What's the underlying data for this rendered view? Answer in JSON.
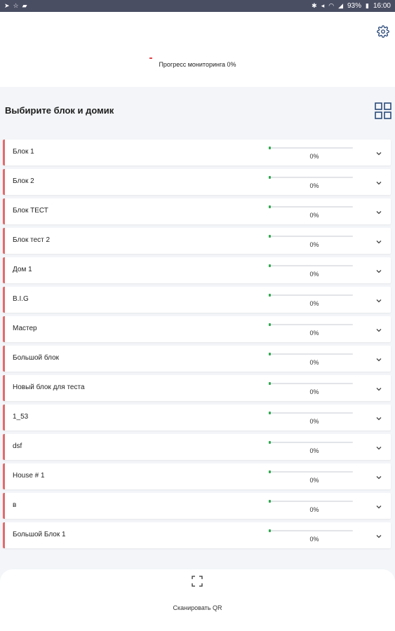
{
  "status_bar": {
    "battery": "93%",
    "time": "16:00"
  },
  "header": {
    "progress_label": "Прогресс мониторинга 0%"
  },
  "section": {
    "title": "Выбирите блок и домик"
  },
  "blocks": [
    {
      "name": "Блок 1",
      "percent": "0%",
      "progress": 0
    },
    {
      "name": "Блок 2",
      "percent": "0%",
      "progress": 0
    },
    {
      "name": "Блок ТЕСТ",
      "percent": "0%",
      "progress": 0
    },
    {
      "name": "Блок тест 2",
      "percent": "0%",
      "progress": 0
    },
    {
      "name": "Дом 1",
      "percent": "0%",
      "progress": 0
    },
    {
      "name": "B.I.G",
      "percent": "0%",
      "progress": 0
    },
    {
      "name": "Мастер",
      "percent": "0%",
      "progress": 0
    },
    {
      "name": "Большой блок",
      "percent": "0%",
      "progress": 0
    },
    {
      "name": "Новый блок для теста",
      "percent": "0%",
      "progress": 0
    },
    {
      "name": "1_53",
      "percent": "0%",
      "progress": 0
    },
    {
      "name": "dsf",
      "percent": "0%",
      "progress": 0
    },
    {
      "name": "House # 1",
      "percent": "0%",
      "progress": 0
    },
    {
      "name": "в",
      "percent": "0%",
      "progress": 0
    },
    {
      "name": "Большой Блок 1",
      "percent": "0%",
      "progress": 0
    }
  ],
  "bottom": {
    "scan_label": "Сканировать QR"
  },
  "colors": {
    "status_bar": "#4a4e63",
    "row_accent": "#e16c6c",
    "progress_fill": "#2fa84f",
    "background": "#f3f5f8",
    "grid_icon": "#2b4a7a"
  }
}
